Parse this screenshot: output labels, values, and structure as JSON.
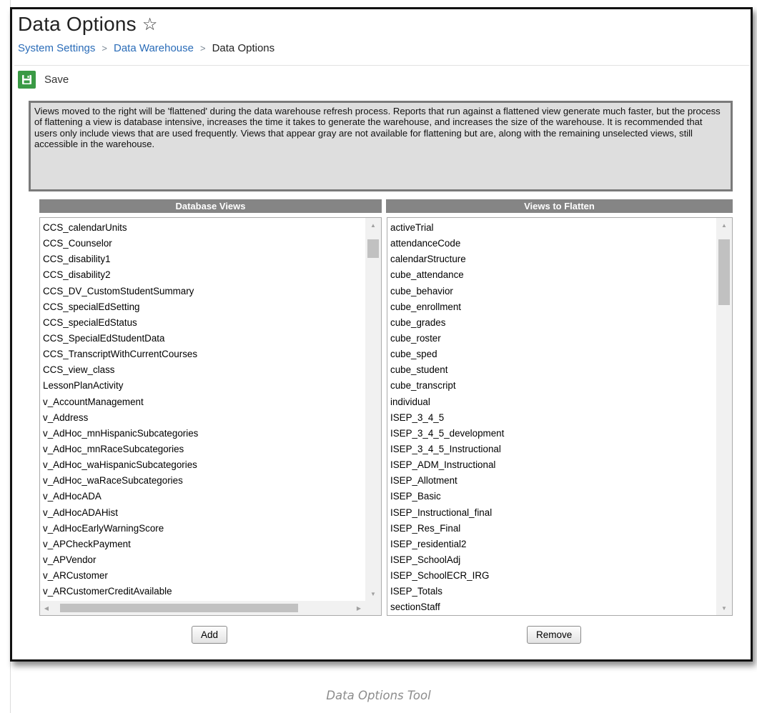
{
  "header": {
    "title": "Data Options",
    "favorite_icon": "star-outline-icon"
  },
  "breadcrumb": {
    "items": [
      "System Settings",
      "Data Warehouse",
      "Data Options"
    ],
    "separator": ">"
  },
  "toolbar": {
    "save_label": "Save",
    "save_icon": "floppy-disk-icon",
    "save_color": "#3a9a45"
  },
  "notice_text": "Views moved to the right will be 'flattened' during the data warehouse refresh process. Reports that run against a flattened view generate much faster, but the process of flattening a view is database intensive, increases the time it takes to generate the warehouse, and increases the size of the warehouse. It is recommended that users only include views that are used frequently. Views that appear gray are not available for flattening but are, along with the remaining unselected views, still accessible in the warehouse.",
  "database_views": {
    "header": "Database Views",
    "items": [
      "CCS_calendarUnits",
      "CCS_Counselor",
      "CCS_disability1",
      "CCS_disability2",
      "CCS_DV_CustomStudentSummary",
      "CCS_specialEdSetting",
      "CCS_specialEdStatus",
      "CCS_SpecialEdStudentData",
      "CCS_TranscriptWithCurrentCourses",
      "CCS_view_class",
      "LessonPlanActivity",
      "v_AccountManagement",
      "v_Address",
      "v_AdHoc_mnHispanicSubcategories",
      "v_AdHoc_mnRaceSubcategories",
      "v_AdHoc_waHispanicSubcategories",
      "v_AdHoc_waRaceSubcategories",
      "v_AdHocADA",
      "v_AdHocADAHist",
      "v_AdHocEarlyWarningScore",
      "v_APCheckPayment",
      "v_APVendor",
      "v_ARCustomer",
      "v_ARCustomerCreditAvailable"
    ],
    "add_label": "Add"
  },
  "views_to_flatten": {
    "header": "Views to Flatten",
    "items": [
      "activeTrial",
      "attendanceCode",
      "calendarStructure",
      "cube_attendance",
      "cube_behavior",
      "cube_enrollment",
      "cube_grades",
      "cube_roster",
      "cube_sped",
      "cube_student",
      "cube_transcript",
      "individual",
      "ISEP_3_4_5",
      "ISEP_3_4_5_development",
      "ISEP_3_4_5_Instructional",
      "ISEP_ADM_Instructional",
      "ISEP_Allotment",
      "ISEP_Basic",
      "ISEP_Instructional_final",
      "ISEP_Res_Final",
      "ISEP_residential2",
      "ISEP_SchoolAdj",
      "ISEP_SchoolECR_IRG",
      "ISEP_Totals",
      "sectionStaff"
    ],
    "remove_label": "Remove"
  },
  "caption": "Data Options Tool"
}
